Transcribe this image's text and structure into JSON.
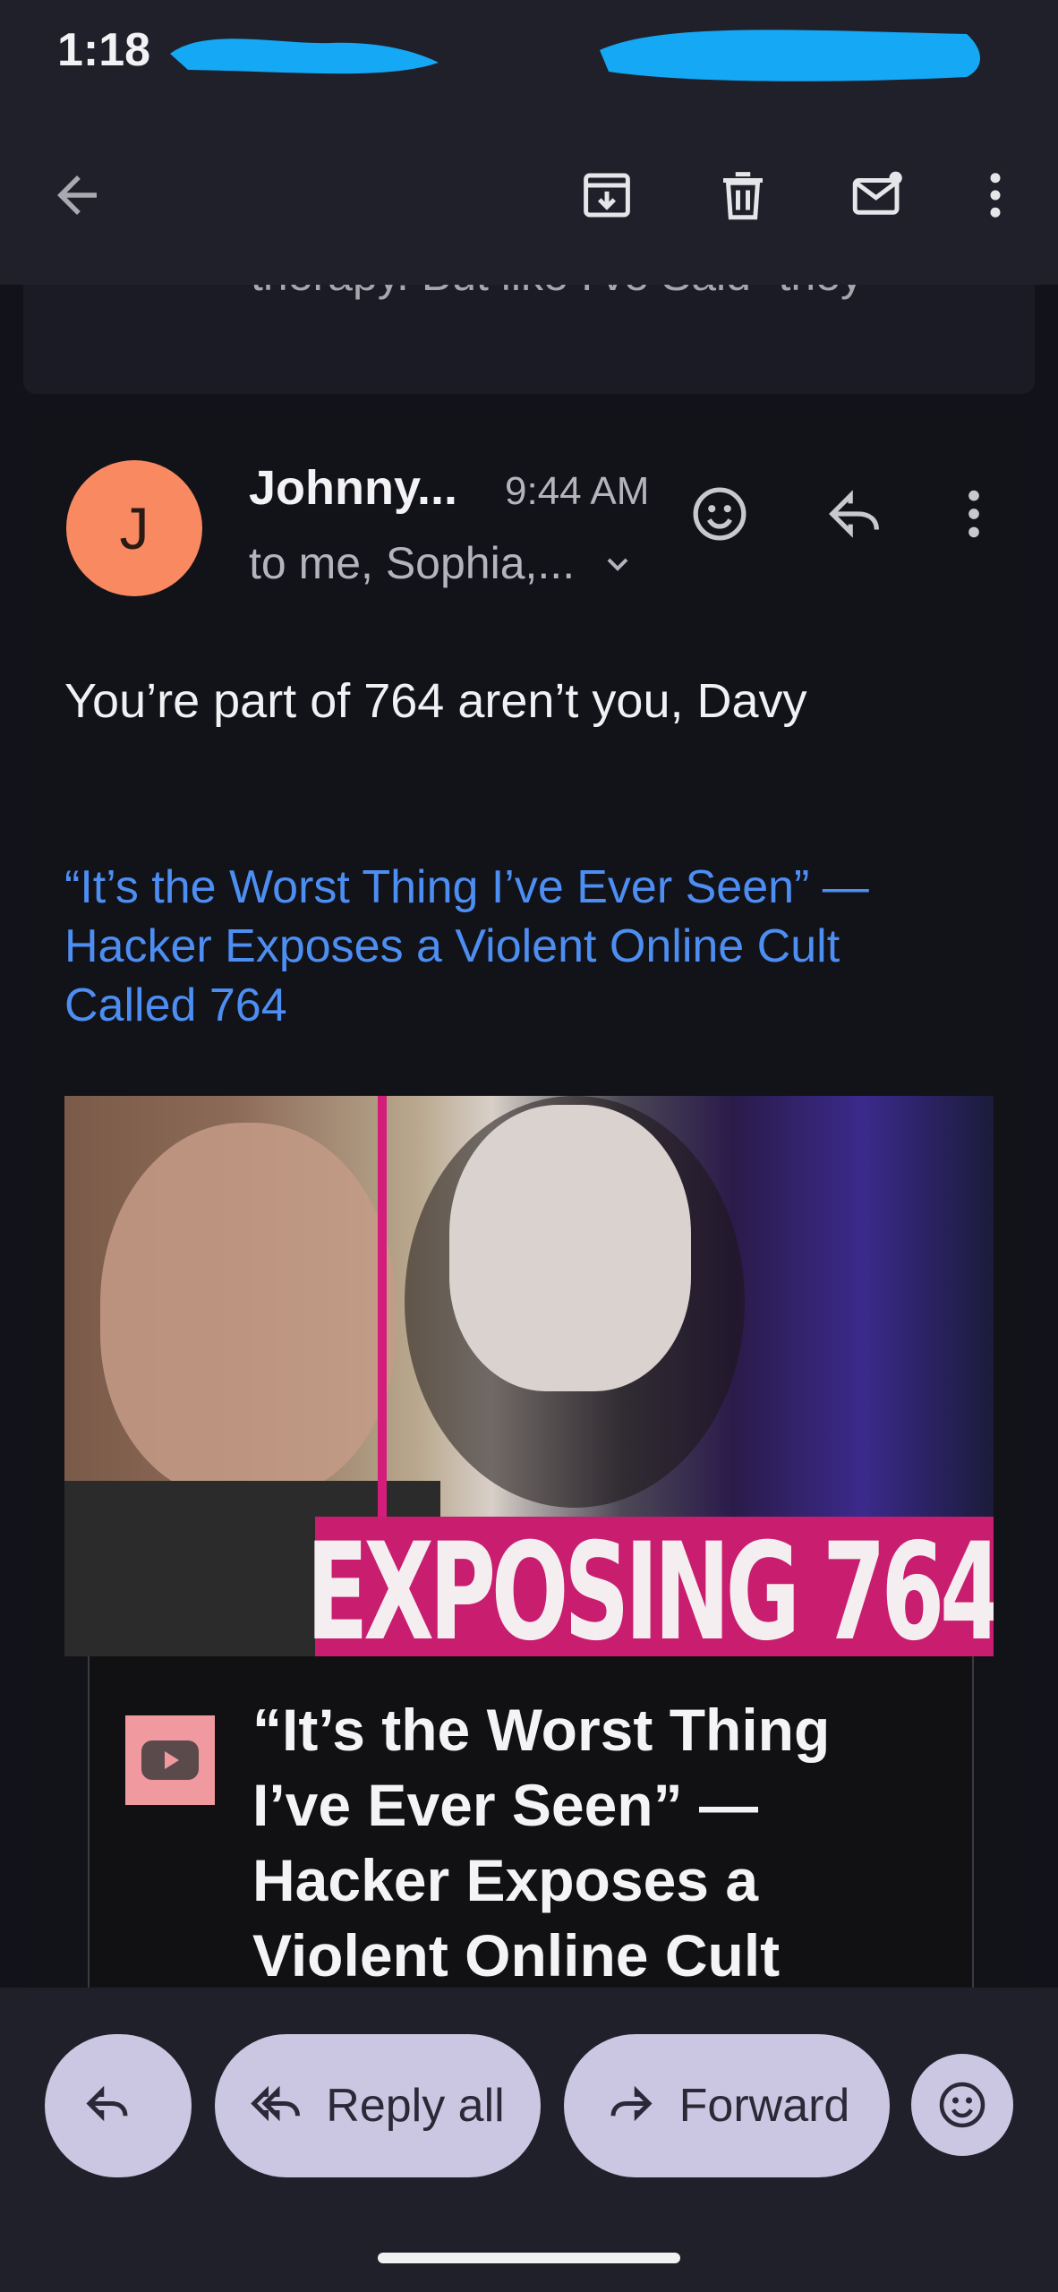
{
  "status_bar": {
    "time": "1:18"
  },
  "toolbar": {
    "back_icon": "arrow-left-icon",
    "archive_icon": "archive-icon",
    "delete_icon": "trash-icon",
    "mark_unread_icon": "mail-unread-icon",
    "more_icon": "more-vertical-icon"
  },
  "previous_message": {
    "snippet": "therapy. But like I've Said- they"
  },
  "message": {
    "avatar_letter": "J",
    "avatar_color": "#f88960",
    "sender": "Johnny...",
    "time": "9:44 AM",
    "recipients": "to me, Sophia,...",
    "body": "You’re part of 764 aren’t you, Davy",
    "link_text": "“It’s the Worst Thing I’ve Ever Seen” — Hacker Exposes a Violent Online Cult Called 764",
    "link_color": "#4d8ef2",
    "preview": {
      "thumbnail_text": "EXPOSING 764",
      "title": "“It’s the Worst Thing I’ve Ever Seen” — Hacker Exposes a Violent Online Cult"
    }
  },
  "actions": {
    "reply_label": "",
    "reply_all_label": "Reply all",
    "forward_label": "Forward",
    "pill_color": "#cbc7e2"
  }
}
